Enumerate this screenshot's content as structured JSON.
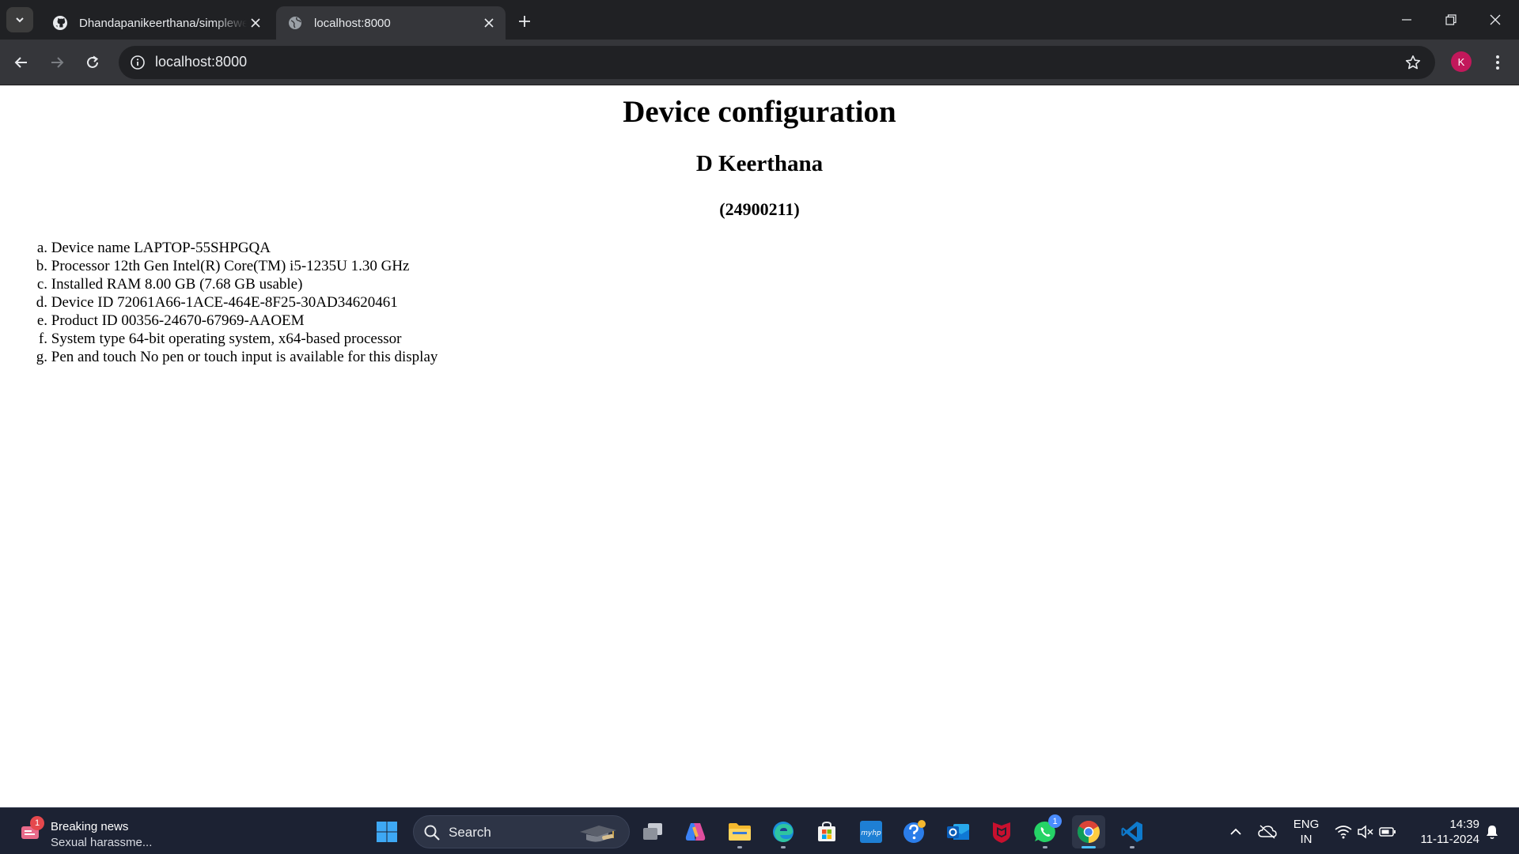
{
  "browser": {
    "tabs": [
      {
        "title": "Dhandapanikeerthana/simplewebsite",
        "favicon": "github-icon",
        "active": false
      },
      {
        "title": "localhost:8000",
        "favicon": "globe-icon",
        "active": true
      }
    ],
    "url": "localhost:8000",
    "profile_initial": "K",
    "profile_color": "#c2185b"
  },
  "page": {
    "title": "Device configuration",
    "name": "D Keerthana",
    "id": "(24900211)",
    "specs": [
      {
        "marker": "a.",
        "text": "Device name LAPTOP-55SHPGQA"
      },
      {
        "marker": "b.",
        "text": "Processor 12th Gen Intel(R) Core(TM) i5-1235U 1.30 GHz"
      },
      {
        "marker": "c.",
        "text": "Installed RAM 8.00 GB (7.68 GB usable)"
      },
      {
        "marker": "d.",
        "text": "Device ID 72061A66-1ACE-464E-8F25-30AD34620461"
      },
      {
        "marker": "e.",
        "text": "Product ID 00356-24670-67969-AAOEM"
      },
      {
        "marker": "f.",
        "text": "System type 64-bit operating system, x64-based processor"
      },
      {
        "marker": "g.",
        "text": "Pen and touch No pen or touch input is available for this display"
      }
    ]
  },
  "taskbar": {
    "news": {
      "badge": "1",
      "title": "Breaking news",
      "subtitle": "Sexual harassme..."
    },
    "search_label": "Search",
    "apps": [
      {
        "name": "start-button",
        "icon": "windows-logo-icon"
      },
      {
        "name": "task-view",
        "icon": "task-view-icon"
      },
      {
        "name": "copilot",
        "icon": "copilot-icon"
      },
      {
        "name": "file-explorer",
        "icon": "folder-icon"
      },
      {
        "name": "edge",
        "icon": "edge-icon"
      },
      {
        "name": "microsoft-store",
        "icon": "store-icon"
      },
      {
        "name": "myhp",
        "icon": "myhp-icon",
        "label": "myhp"
      },
      {
        "name": "get-help",
        "icon": "help-icon"
      },
      {
        "name": "outlook",
        "icon": "outlook-icon"
      },
      {
        "name": "mcafee",
        "icon": "mcafee-icon"
      },
      {
        "name": "whatsapp",
        "icon": "whatsapp-icon",
        "badge": "1"
      },
      {
        "name": "chrome",
        "icon": "chrome-icon"
      },
      {
        "name": "vscode",
        "icon": "vscode-icon"
      }
    ],
    "lang_line1": "ENG",
    "lang_line2": "IN",
    "time": "14:39",
    "date": "11-11-2024"
  }
}
